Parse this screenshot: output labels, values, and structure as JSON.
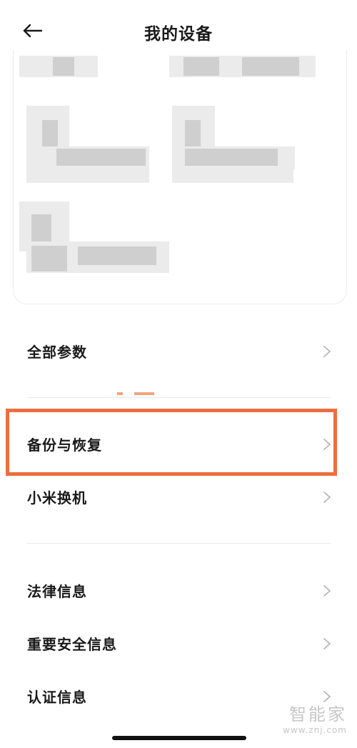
{
  "header": {
    "title": "我的设备",
    "back_icon": "arrow-left-icon"
  },
  "menu": {
    "section1": [
      {
        "id": "all-params",
        "label": "全部参数",
        "icon": "chevron-right-icon"
      }
    ],
    "section2": [
      {
        "id": "backup-restore",
        "label": "备份与恢复",
        "icon": "chevron-right-icon",
        "highlighted": true
      },
      {
        "id": "mi-mover",
        "label": "小米换机",
        "icon": "chevron-right-icon"
      }
    ],
    "section3": [
      {
        "id": "legal-info",
        "label": "法律信息",
        "icon": "chevron-right-icon"
      },
      {
        "id": "safety-info",
        "label": "重要安全信息",
        "icon": "chevron-right-icon"
      },
      {
        "id": "certification-info",
        "label": "认证信息",
        "icon": "chevron-right-icon"
      }
    ]
  },
  "watermark": {
    "main": "智能家",
    "url": "www.znj.com"
  },
  "colors": {
    "highlight": "#ee6d3f",
    "text": "#1a1a1a",
    "chevron": "#b5b5b5",
    "divider": "#e8e8e8"
  }
}
